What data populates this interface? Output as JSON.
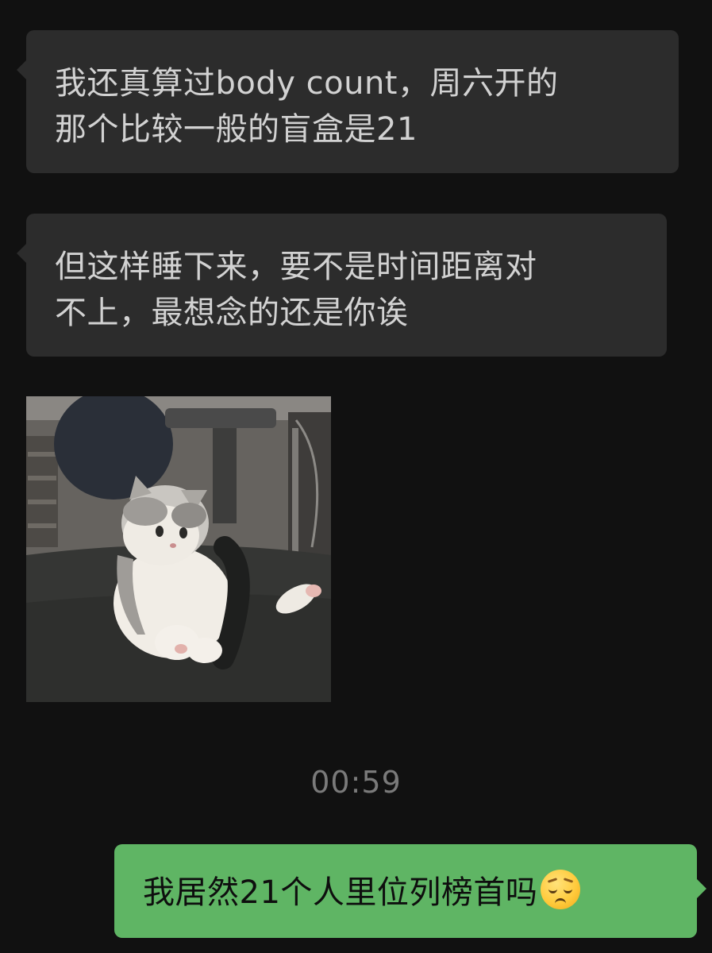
{
  "messages": [
    {
      "direction": "incoming",
      "text": "我还真算过body count，周六开的\n那个比较一般的盲盒是21"
    },
    {
      "direction": "incoming",
      "text": "但这样睡下来，要不是时间距离对\n不上，最想念的还是你诶"
    },
    {
      "direction": "incoming",
      "type": "image",
      "image": "cat-sticker"
    },
    {
      "direction": "outgoing",
      "text": "我居然21个人里位列榜首吗",
      "emoji": "pensive-face-emoji"
    }
  ],
  "timestamp": "00:59",
  "colors": {
    "background": "#111111",
    "incoming_bubble": "#2c2c2c",
    "incoming_text": "#d2d2d2",
    "outgoing_bubble": "#5fb564",
    "outgoing_text": "#0e0e0e",
    "timestamp_text": "#7a7a7a"
  }
}
